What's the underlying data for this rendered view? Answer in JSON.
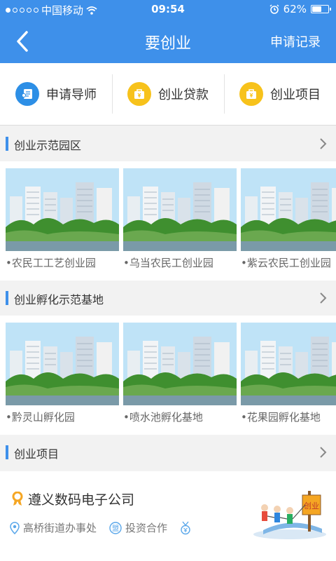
{
  "status_bar": {
    "carrier": "中国移动",
    "time": "09:54",
    "battery": "62%",
    "battery_level": 0.62
  },
  "navbar": {
    "title": "要创业",
    "record_label": "申请记录"
  },
  "quick_actions": [
    {
      "label": "申请导师",
      "icon": "mentor-icon",
      "color": "#2d8fe6"
    },
    {
      "label": "创业贷款",
      "icon": "loan-icon",
      "color": "#f7c21b"
    },
    {
      "label": "创业项目",
      "icon": "project-icon",
      "color": "#f7c21b"
    }
  ],
  "sections": [
    {
      "title": "创业示范园区",
      "items": [
        {
          "caption": "•农民工工艺创业园"
        },
        {
          "caption": "•乌当农民工创业园"
        },
        {
          "caption": "•紫云农民工创业园"
        }
      ]
    },
    {
      "title": "创业孵化示范基地",
      "items": [
        {
          "caption": "•黔灵山孵化园"
        },
        {
          "caption": "•喷水池孵化基地"
        },
        {
          "caption": "•花果园孵化基地"
        }
      ]
    },
    {
      "title": "创业项目"
    }
  ],
  "company": {
    "name": "遵义数码电子公司",
    "location": "高桥街道办事处",
    "coop_badge": "盟",
    "coop_label": "投资合作",
    "sign_text": "创业"
  },
  "colors": {
    "accent": "#3e90ea",
    "yellow": "#f7c21b"
  }
}
